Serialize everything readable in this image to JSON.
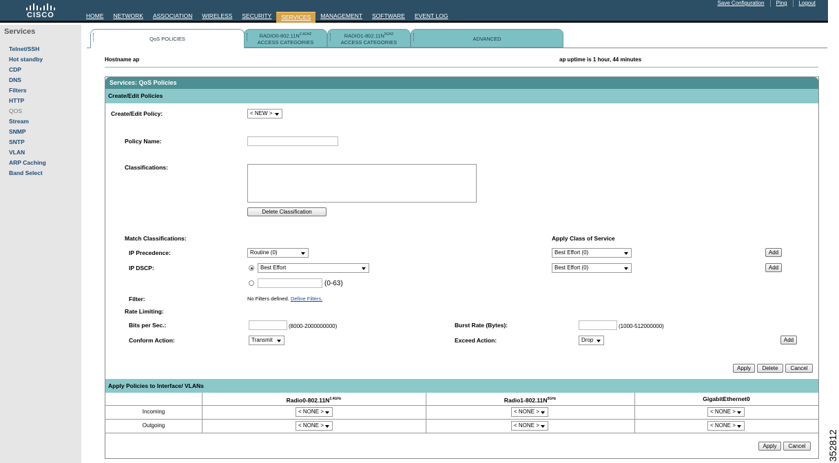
{
  "brand": {
    "logo_text": "CISCO"
  },
  "top_nav": {
    "items": [
      "HOME",
      "NETWORK",
      "ASSOCIATION",
      "WIRELESS",
      "SECURITY",
      "SERVICES",
      "MANAGEMENT",
      "SOFTWARE",
      "EVENT LOG"
    ],
    "active": "SERVICES"
  },
  "top_links": [
    "Save Configuration",
    "Ping",
    "Logout"
  ],
  "sidebar": {
    "title": "Services",
    "items": [
      "Telnet/SSH",
      "Hot standby",
      "CDP",
      "DNS",
      "Filters",
      "HTTP",
      "QOS",
      "Stream",
      "SNMP",
      "SNTP",
      "VLAN",
      "ARP Caching",
      "Band Select"
    ],
    "current": "QOS"
  },
  "tabs": {
    "qos": "QoS POLICIES",
    "radio0_line1": "RADIO0-802.11N",
    "radio0_sup": "2.4GHZ",
    "radio0_line2": "ACCESS CATEGORIES",
    "radio1_line1": "RADIO1-802.11N",
    "radio1_sup": "5GHZ",
    "radio1_line2": "ACCESS CATEGORIES",
    "advanced": "ADVANCED"
  },
  "status": {
    "hostname_label": "Hostname",
    "hostname_value": "ap",
    "uptime": "ap uptime is 1 hour, 44 minutes"
  },
  "panel": {
    "title": "Services: QoS Policies",
    "create_section": "Create/Edit Policies",
    "create_edit_label": "Create/Edit Policy:",
    "create_edit_value": "< NEW >",
    "policy_name_label": "Policy Name:",
    "policy_name_value": "",
    "classifications_label": "Classifications:",
    "delete_classification_button": "Delete Classification",
    "match_label": "Match Classifications:",
    "apply_cos_label": "Apply Class of Service",
    "ip_precedence_label": "IP Precedence:",
    "ip_precedence_value": "Routine (0)",
    "ip_precedence_cos": "Best Effort (0)",
    "ip_dscp_label": "IP DSCP:",
    "ip_dscp_value": "Best Effort",
    "ip_dscp_cos": "Best Effort (0)",
    "dscp_range": "(0-63)",
    "add_button": "Add",
    "filter_label": "Filter:",
    "filter_note": "No Filters defined.",
    "filter_link": "Define Filters.",
    "rate_limiting_label": "Rate Limiting:",
    "bits_label": "Bits per Sec.:",
    "bits_range": "(8000-2000000000)",
    "burst_label": "Burst Rate (Bytes):",
    "burst_range": "(1000-512000000)",
    "conform_label": "Conform Action:",
    "conform_value": "Transmit",
    "exceed_label": "Exceed Action:",
    "exceed_value": "Drop",
    "apply_button": "Apply",
    "delete_button": "Delete",
    "cancel_button": "Cancel"
  },
  "interfaces": {
    "section": "Apply Policies to Interface/ VLANs",
    "radio0": "Radio0-802.11N",
    "radio0_sup": "2.4GHz",
    "radio1": "Radio1-802.11N",
    "radio1_sup": "5GHz",
    "gig": "GigabitEthernet0",
    "incoming": "Incoming",
    "outgoing": "Outgoing",
    "none": "< NONE >",
    "apply_button": "Apply",
    "cancel_button": "Cancel"
  },
  "figure_id": "352812"
}
